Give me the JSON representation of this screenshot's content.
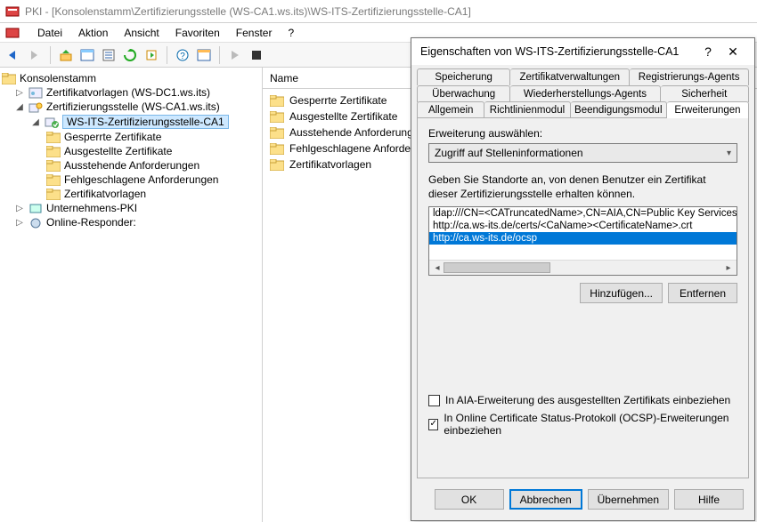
{
  "window": {
    "title": "PKI - [Konsolenstamm\\Zertifizierungsstelle (WS-CA1.ws.its)\\WS-ITS-Zertifizierungsstelle-CA1]"
  },
  "menu": {
    "datei": "Datei",
    "aktion": "Aktion",
    "ansicht": "Ansicht",
    "favoriten": "Favoriten",
    "fenster": "Fenster",
    "help": "?"
  },
  "tree": {
    "root": "Konsolenstamm",
    "items": [
      "Zertifikatvorlagen (WS-DC1.ws.its)",
      "Zertifizierungsstelle (WS-CA1.ws.its)",
      "WS-ITS-Zertifizierungsstelle-CA1",
      "Gesperrte Zertifikate",
      "Ausgestellte Zertifikate",
      "Ausstehende Anforderungen",
      "Fehlgeschlagene Anforderungen",
      "Zertifikatvorlagen",
      "Unternehmens-PKI",
      "Online-Responder:"
    ]
  },
  "list": {
    "header": "Name",
    "items": [
      "Gesperrte Zertifikate",
      "Ausgestellte Zertifikate",
      "Ausstehende Anforderungen",
      "Fehlgeschlagene Anforderungen",
      "Zertifikatvorlagen"
    ]
  },
  "dialog": {
    "title": "Eigenschaften von WS-ITS-Zertifizierungsstelle-CA1",
    "tabs_row1": [
      "Speicherung",
      "Zertifikatverwaltungen",
      "Registrierungs-Agents"
    ],
    "tabs_row2": [
      "Überwachung",
      "Wiederherstellungs-Agents",
      "Sicherheit"
    ],
    "tabs_row3": [
      "Allgemein",
      "Richtlinienmodul",
      "Beendigungsmodul",
      "Erweiterungen"
    ],
    "active_tab": "Erweiterungen",
    "ext_label": "Erweiterung auswählen:",
    "ext_value": "Zugriff auf Stelleninformationen",
    "desc": "Geben Sie Standorte an, von denen Benutzer ein Zertifikat dieser Zertifizierungsstelle erhalten können.",
    "locations": [
      "ldap:///CN=<CATruncatedName>,CN=AIA,CN=Public Key Services,CN=S",
      "http://ca.ws-its.de/certs/<CaName><CertificateName>.crt",
      "http://ca.ws-its.de/ocsp"
    ],
    "add_btn": "Hinzufügen...",
    "remove_btn": "Entfernen",
    "chk_aia": "In AIA-Erweiterung des ausgestellten Zertifikats einbeziehen",
    "chk_ocsp": "In Online Certificate Status-Protokoll (OCSP)-Erweiterungen einbeziehen",
    "ok": "OK",
    "cancel": "Abbrechen",
    "apply": "Übernehmen",
    "help": "Hilfe"
  }
}
